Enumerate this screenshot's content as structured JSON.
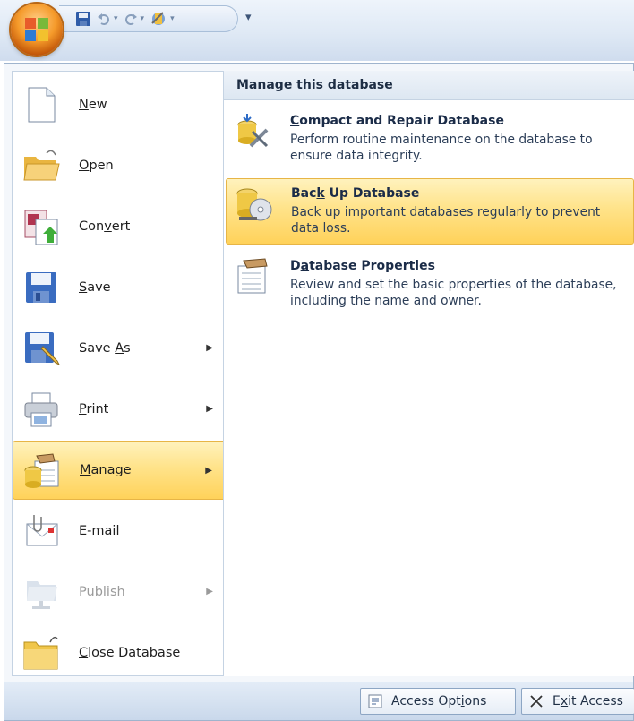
{
  "quick_access": {
    "save_icon": "save-icon",
    "undo_icon": "undo-icon",
    "redo_icon": "redo-icon",
    "tools_icon": "tools-icon",
    "customize_symbol": "▾"
  },
  "file_menu": {
    "items": [
      {
        "label_pre": "",
        "label_u": "N",
        "label_post": "ew",
        "icon": "new-document-icon",
        "has_submenu": false
      },
      {
        "label_pre": "",
        "label_u": "O",
        "label_post": "pen",
        "icon": "open-folder-icon",
        "has_submenu": false
      },
      {
        "label_pre": "Con",
        "label_u": "v",
        "label_post": "ert",
        "icon": "convert-icon",
        "has_submenu": false
      },
      {
        "label_pre": "",
        "label_u": "S",
        "label_post": "ave",
        "icon": "save-icon",
        "has_submenu": false
      },
      {
        "label_pre": "Save ",
        "label_u": "A",
        "label_post": "s",
        "icon": "save-as-icon",
        "has_submenu": true
      },
      {
        "label_pre": "",
        "label_u": "P",
        "label_post": "rint",
        "icon": "print-icon",
        "has_submenu": true
      },
      {
        "label_pre": "",
        "label_u": "M",
        "label_post": "anage",
        "icon": "manage-icon",
        "has_submenu": true,
        "highlighted": true
      },
      {
        "label_pre": "",
        "label_u": "E",
        "label_post": "-mail",
        "icon": "email-icon",
        "has_submenu": false
      },
      {
        "label_pre": "P",
        "label_u": "u",
        "label_post": "blish",
        "icon": "publish-icon",
        "has_submenu": true,
        "disabled": true
      },
      {
        "label_pre": "",
        "label_u": "C",
        "label_post": "lose Database",
        "icon": "close-database-icon",
        "has_submenu": false
      }
    ]
  },
  "submenu": {
    "title": "Manage this database",
    "items": [
      {
        "title_pre": "",
        "title_u": "C",
        "title_post": "ompact and Repair Database",
        "desc": "Perform routine maintenance on the database to ensure data integrity.",
        "icon": "compact-repair-icon"
      },
      {
        "title_pre": "Bac",
        "title_u": "k",
        "title_post": " Up Database",
        "desc": "Back up important databases regularly to prevent data loss.",
        "icon": "backup-database-icon",
        "highlighted": true
      },
      {
        "title_pre": "D",
        "title_u": "a",
        "title_post": "tabase Properties",
        "desc": "Review and set the basic properties of the database, including the name and owner.",
        "icon": "database-properties-icon"
      }
    ]
  },
  "bottom": {
    "options": {
      "pre": "Access Opt",
      "u": "i",
      "post": "ons"
    },
    "exit": {
      "pre": "E",
      "u": "x",
      "post": "it Access"
    }
  }
}
